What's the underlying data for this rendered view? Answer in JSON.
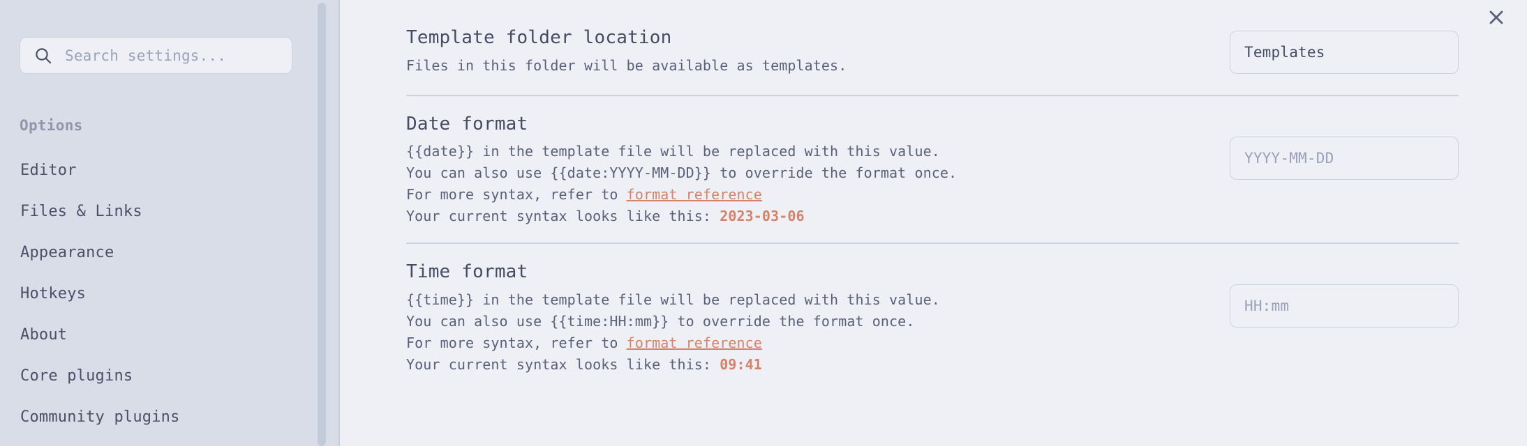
{
  "sidebar": {
    "search": {
      "placeholder": "Search settings...",
      "value": "",
      "icon": "search-icon"
    },
    "section_title": "Options",
    "items": [
      {
        "label": "Editor"
      },
      {
        "label": "Files & Links"
      },
      {
        "label": "Appearance"
      },
      {
        "label": "Hotkeys"
      },
      {
        "label": "About"
      },
      {
        "label": "Core plugins"
      },
      {
        "label": "Community plugins"
      }
    ]
  },
  "header": {
    "close_icon": "close-icon"
  },
  "colors": {
    "accent": "#d4826a",
    "sidebar_bg": "#d9dde8",
    "main_bg": "#eef0f5",
    "text": "#474c63",
    "muted": "#9aa1b8",
    "border": "#ccd2e0"
  },
  "settings": [
    {
      "name": "Template folder location",
      "desc_lines": [
        {
          "text": "Files in this folder will be available as templates."
        }
      ],
      "input": {
        "value": "Templates",
        "placeholder": ""
      }
    },
    {
      "name": "Date format",
      "desc_lines": [
        {
          "text": "{{date}} in the template file will be replaced with this value."
        },
        {
          "text": "You can also use {{date:YYYY-MM-DD}} to override the format once."
        },
        {
          "prefix": "For more syntax, refer to ",
          "link": "format reference"
        },
        {
          "prefix": "Your current syntax looks like this: ",
          "accent": "2023-03-06"
        }
      ],
      "input": {
        "value": "",
        "placeholder": "YYYY-MM-DD"
      }
    },
    {
      "name": "Time format",
      "desc_lines": [
        {
          "text": "{{time}} in the template file will be replaced with this value."
        },
        {
          "text": "You can also use {{time:HH:mm}} to override the format once."
        },
        {
          "prefix": "For more syntax, refer to ",
          "link": "format reference"
        },
        {
          "prefix": "Your current syntax looks like this: ",
          "accent": "09:41"
        }
      ],
      "input": {
        "value": "",
        "placeholder": "HH:mm"
      }
    }
  ]
}
